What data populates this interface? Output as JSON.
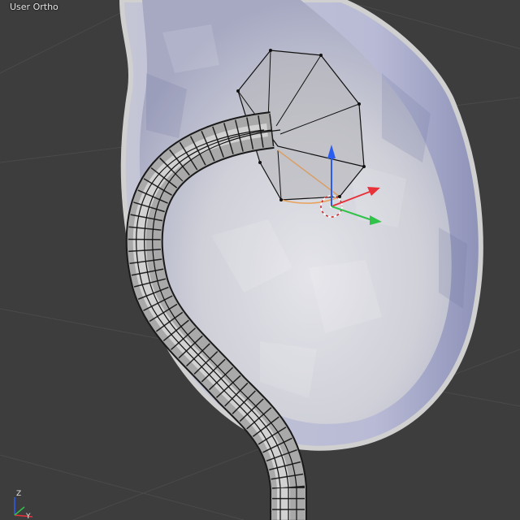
{
  "viewport": {
    "view_label": "User Ortho"
  },
  "axis_widget": {
    "z_label": "Z",
    "y_label": "Y"
  },
  "colors": {
    "background": "#3d3d3d",
    "grid": "#4a4a4a",
    "mesh_fill": "#c9c9cf",
    "mesh_shadow": "#9a9db5",
    "wire": "#111111",
    "selection": "#e8a25c",
    "axis_x": "#e8323a",
    "axis_y": "#31c24a",
    "axis_z": "#2b5cf0"
  },
  "icons": {
    "manipulator": "transform-manipulator-icon",
    "cursor": "3d-cursor-icon"
  }
}
